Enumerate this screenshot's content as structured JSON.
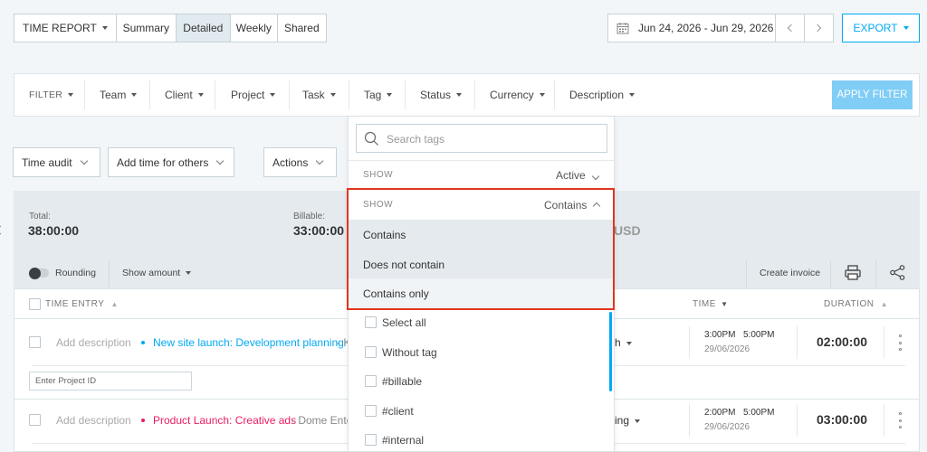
{
  "topbar": {
    "report_type": "TIME REPORT",
    "tabs": [
      "Summary",
      "Detailed",
      "Weekly",
      "Shared"
    ],
    "date_range": "Jun 24, 2026 - Jun 29, 2026",
    "export_label": "EXPORT"
  },
  "filter": {
    "label": "FILTER",
    "items": [
      "Team",
      "Client",
      "Project",
      "Task",
      "Tag",
      "Status",
      "Currency",
      "Description"
    ],
    "apply_label": "APPLY FILTER"
  },
  "actions_row": {
    "time_audit": "Time audit",
    "add_time": "Add time for others",
    "actions": "Actions"
  },
  "summary": {
    "total_label": "Total:",
    "total_value": "38:00:00",
    "billable_label": "Billable:",
    "billable_value": "33:00:00",
    "amount_suffix": "USD"
  },
  "toolbar": {
    "rounding": "Rounding",
    "show_amount": "Show amount",
    "create_invoice": "Create invoice"
  },
  "table": {
    "headers": {
      "time_entry": "TIME ENTRY",
      "time": "TIME",
      "duration": "DURATION"
    },
    "rows": [
      {
        "description": "Add description",
        "project": "New site launch: Development planning",
        "client_fragment": "- K",
        "user_fragment": "h",
        "start": "3:00PM",
        "end": "5:00PM",
        "date": "29/06/2026",
        "duration": "02:00:00",
        "project_color": "#03a9f4"
      },
      {
        "description": "Add description",
        "project": "Product Launch: Creative ads",
        "client_fragment": "- Dome Ente...",
        "user_fragment": "ing",
        "start": "2:00PM",
        "end": "5:00PM",
        "date": "29/06/2026",
        "duration": "03:00:00",
        "project_color": "#e91e63"
      }
    ],
    "project_id_placeholder": "Enter Project ID"
  },
  "tag_dropdown": {
    "search_placeholder": "Search tags",
    "show_label_1": "SHOW",
    "show_value_1": "Active",
    "show_label_2": "SHOW",
    "show_value_2": "Contains",
    "options": [
      "Contains",
      "Does not contain",
      "Contains only"
    ],
    "checklist": [
      "Select all",
      "Without tag",
      "#billable",
      "#client",
      "#internal"
    ]
  },
  "colors": {
    "accent": "#03a9f4",
    "apply_button": "#80cdf5",
    "highlight_border": "#e0361f",
    "project_pink": "#e91e63"
  }
}
